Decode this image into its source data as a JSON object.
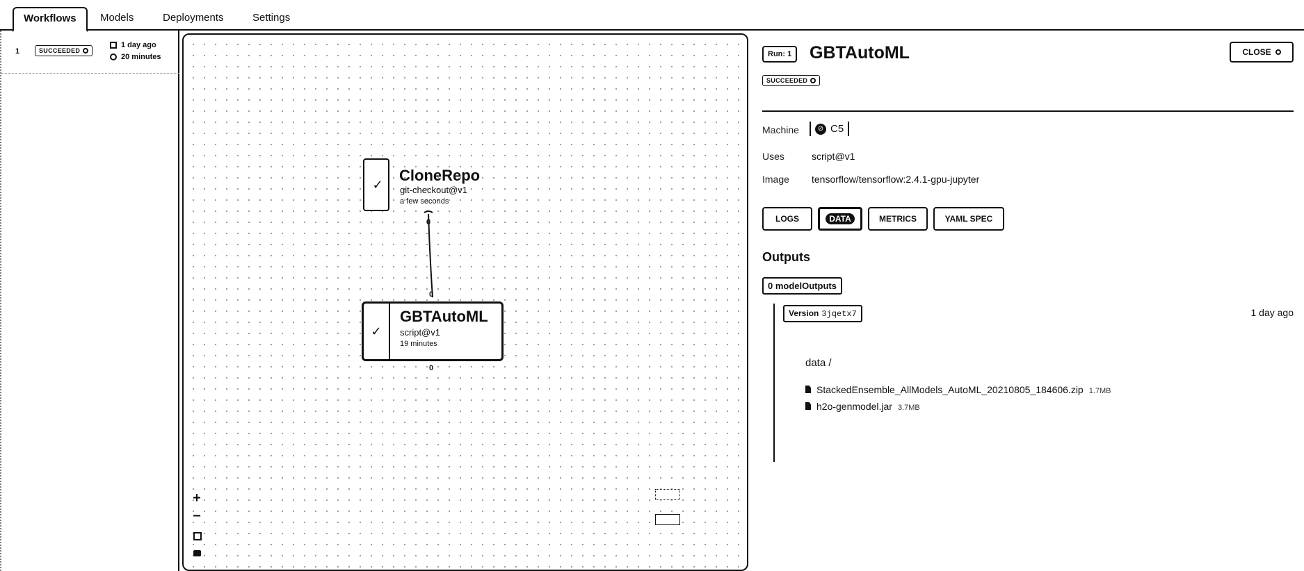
{
  "tabs": [
    {
      "label": "Workflows",
      "active": true
    },
    {
      "label": "Models",
      "active": false
    },
    {
      "label": "Deployments",
      "active": false
    },
    {
      "label": "Settings",
      "active": false
    }
  ],
  "runs_list": [
    {
      "number": "1",
      "status": "SUCCEEDED",
      "date": "1 day ago",
      "duration": "20 minutes"
    }
  ],
  "graph": {
    "nodes": [
      {
        "title": "CloneRepo",
        "uses": "git-checkout@v1",
        "time": "a few seconds",
        "status_icon": "checkmark-icon",
        "selected": false
      },
      {
        "title": "GBTAutoML",
        "uses": "script@v1",
        "time": "19 minutes",
        "status_icon": "checkmark-icon",
        "selected": true
      }
    ],
    "edge_labels": [
      "0",
      "0",
      "0"
    ],
    "controls": {
      "zoom_in": "+",
      "zoom_out": "−"
    }
  },
  "detail": {
    "run_chip": "Run: 1",
    "title": "GBTAutoML",
    "close_label": "CLOSE",
    "status": "SUCCEEDED",
    "machine_label": "Machine",
    "machine_value": "C5",
    "uses_label": "Uses",
    "uses_value": "script@v1",
    "image_label": "Image",
    "image_value": "tensorflow/tensorflow:2.4.1-gpu-jupyter",
    "subtabs": [
      {
        "label": "LOGS",
        "active": false
      },
      {
        "label": "DATA",
        "active": true
      },
      {
        "label": "METRICS",
        "active": false
      },
      {
        "label": "YAML SPEC",
        "active": false
      }
    ],
    "outputs_heading": "Outputs",
    "outputs_count": "0 modelOutputs",
    "version_label": "Version",
    "version_id": "3jqetx7",
    "version_time": "1 day ago",
    "folder": "data /",
    "files": [
      {
        "name": "StackedEnsemble_AllModels_AutoML_20210805_184606.zip",
        "size": "1.7MB"
      },
      {
        "name": "h2o-genmodel.jar",
        "size": "3.7MB"
      }
    ]
  },
  "colors": {
    "ink": "#111111",
    "background": "#ffffff",
    "grid_dot": "#9a9a9a"
  }
}
